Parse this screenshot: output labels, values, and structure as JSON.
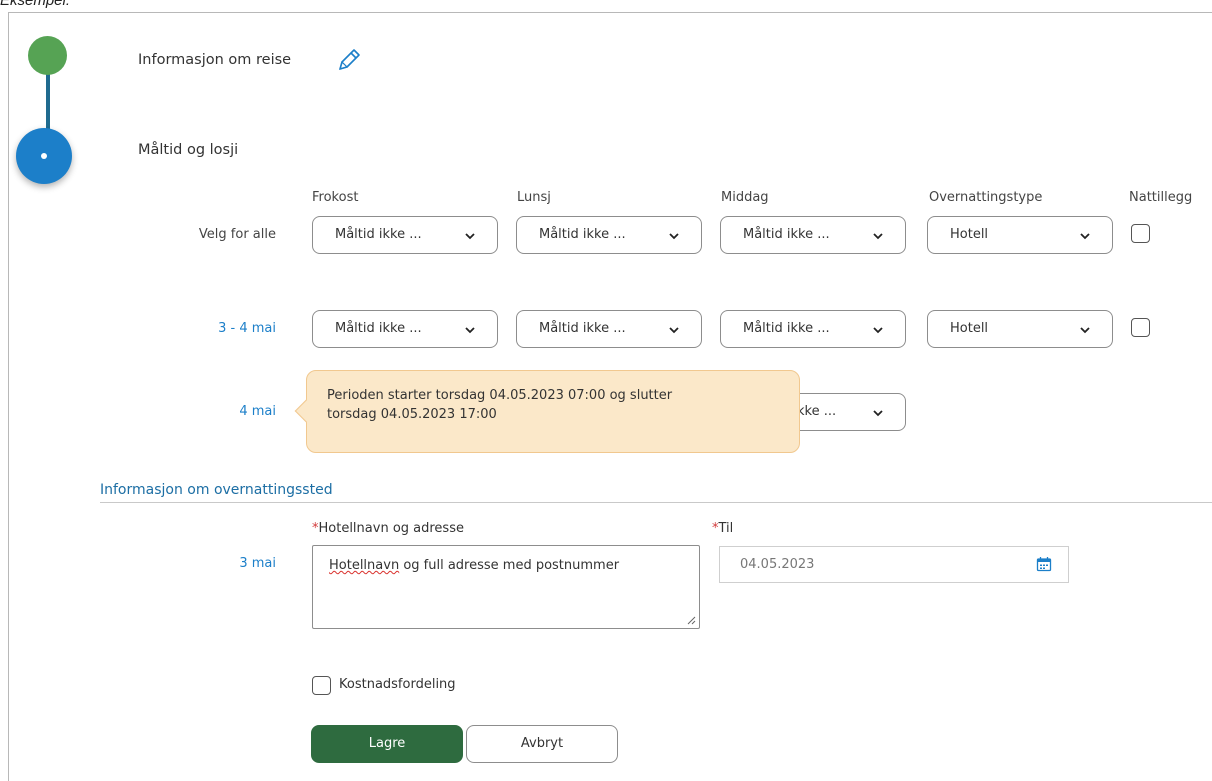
{
  "caption": "Eksempel:",
  "steps": [
    {
      "title": "Informasjon om reise",
      "status": "done"
    },
    {
      "title": "Måltid og losji",
      "status": "active"
    }
  ],
  "columns": {
    "frokost": "Frokost",
    "lunsj": "Lunsj",
    "middag": "Middag",
    "overnattingstype": "Overnattingstype",
    "nattillegg": "Nattillegg"
  },
  "rows": [
    {
      "label": "Velg for alle",
      "frokost": "Måltid ikke ...",
      "lunsj": "Måltid ikke ...",
      "middag": "Måltid ikke ...",
      "overnatting": "Hotell"
    },
    {
      "label": "3 - 4 mai",
      "frokost": "Måltid ikke ...",
      "lunsj": "Måltid ikke ...",
      "middag": "Måltid ikke ...",
      "overnatting": "Hotell"
    },
    {
      "label": "4 mai",
      "middag_partial": "kke ..."
    }
  ],
  "tooltip": {
    "line1": "Perioden starter torsdag 04.05.2023 07:00 og slutter",
    "line2": "torsdag 04.05.2023 17:00"
  },
  "lodging": {
    "section_title": "Informasjon om overnattingssted",
    "hotel_label": "Hotellnavn og adresse",
    "to_label": "Til",
    "required_mark": "*",
    "row_label": "3 mai",
    "hotel_value_word1": "Hotellnavn",
    "hotel_value_rest": " og full adresse med postnummer",
    "to_value": "04.05.2023"
  },
  "cost_label": "Kostnadsfordeling",
  "buttons": {
    "save": "Lagre",
    "cancel": "Avbryt"
  },
  "colors": {
    "step_done": "#56a354",
    "step_active": "#1c7fc9",
    "primary_button": "#2e6b3f",
    "tooltip_bg": "#fbe8c9",
    "link_blue": "#1c7fc9"
  },
  "icons": [
    "pencil-icon",
    "chevron-down-icon",
    "calendar-icon",
    "resize-grip-icon"
  ]
}
